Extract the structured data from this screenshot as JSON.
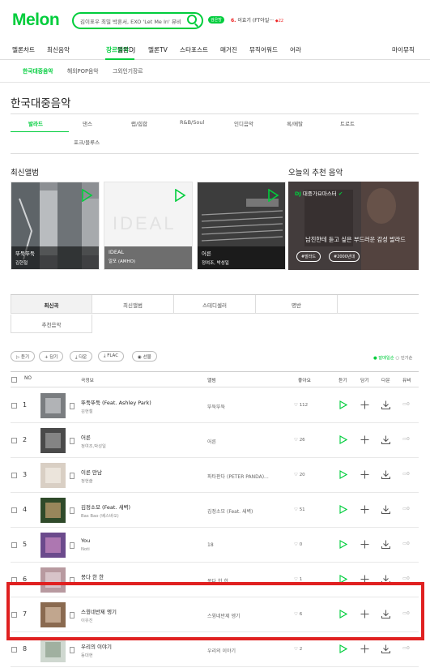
{
  "header": {
    "logo": "Melon",
    "search_text": "김이표우 최밀 박혼서, EXO 'Let Me In' 뮤비",
    "badge": "검은방",
    "rank_no": "6.",
    "rank_text": "이효기 (FT아일···",
    "rank_delta": "◆22"
  },
  "gnb": [
    "멜론차트",
    "최신음악",
    "장르음악",
    "멜론DJ",
    "멜론TV",
    "스타포스트",
    "매거진",
    "뮤직어워드",
    "어라",
    "마이뮤직"
  ],
  "subnav": [
    "한국대중음악",
    "해외POP음악",
    "그외인기장르"
  ],
  "page_title": "한국대중음악",
  "genre_tabs": [
    "발라드",
    "댄스",
    "랩/힙합",
    "R&B/Soul",
    "인디음악",
    "록/메탈",
    "트로트",
    "포크/블루스"
  ],
  "new_albums": {
    "heading": "최신앨범",
    "items": [
      {
        "title": "뚜둑뚜둑",
        "artist": "김현철"
      },
      {
        "title": "IDEAL",
        "artist": "알포 (AMHO)"
      },
      {
        "title": "어른",
        "artist": "정여조, 박성일"
      }
    ]
  },
  "recommend": {
    "heading": "오늘의 추천 음악",
    "dj_label": "DJ",
    "dj_name": "대중가요마스터",
    "desc": "남친한테 듣고 싶은 부드러운 감성 발라드",
    "tags": [
      "#발라드",
      "#2000년대"
    ]
  },
  "list_tabs": [
    "최신곡",
    "최신앨범",
    "스테디셀러",
    "명반",
    "추천음악"
  ],
  "buttons": [
    "듣기",
    "담기",
    "다운",
    "FLAC",
    "선물"
  ],
  "sort": {
    "active": "발매일순",
    "other": "인기순"
  },
  "table_head": {
    "no": "NO",
    "song": "곡정보",
    "album": "앨범",
    "like": "좋아요",
    "listen": "듣기",
    "add": "담기",
    "down": "다운",
    "mv": "뮤비"
  },
  "rows": [
    {
      "no": "1",
      "title": "뚜둑뚜둑 (Feat. Ashley Park)",
      "artist": "김현철",
      "album": "뚜둑뚜둑",
      "likes": "112"
    },
    {
      "no": "2",
      "title": "어른",
      "artist": "정여조,박성일",
      "album": "어른",
      "likes": "26"
    },
    {
      "no": "3",
      "title": "이른 만남",
      "artist": "정현솔",
      "album": "파타판다 (PETER PANDA)...",
      "likes": "20"
    },
    {
      "no": "4",
      "title": "김정소모 (Feat. 새벽)",
      "artist": "Bas Bao (베스바오)",
      "album": "김정소모 (Feat. 새벽)",
      "likes": "51"
    },
    {
      "no": "5",
      "title": "You",
      "artist": "Noti",
      "album": "18",
      "likes": "0"
    },
    {
      "no": "6",
      "title": "몽다 한 한",
      "artist": "",
      "album": "몽다 한 한",
      "likes": "1"
    },
    {
      "no": "7",
      "title": "스윙네반제 엥기",
      "artist": "이유진",
      "album": "스윙네반제 엥기",
      "likes": "6"
    },
    {
      "no": "8",
      "title": "우리의 이야기",
      "artist": "동대현",
      "album": "우리의 이야기",
      "likes": "2"
    }
  ],
  "mv_label": "0",
  "colors": {
    "accent": "#00cd3c",
    "highlight": "#e02020"
  }
}
